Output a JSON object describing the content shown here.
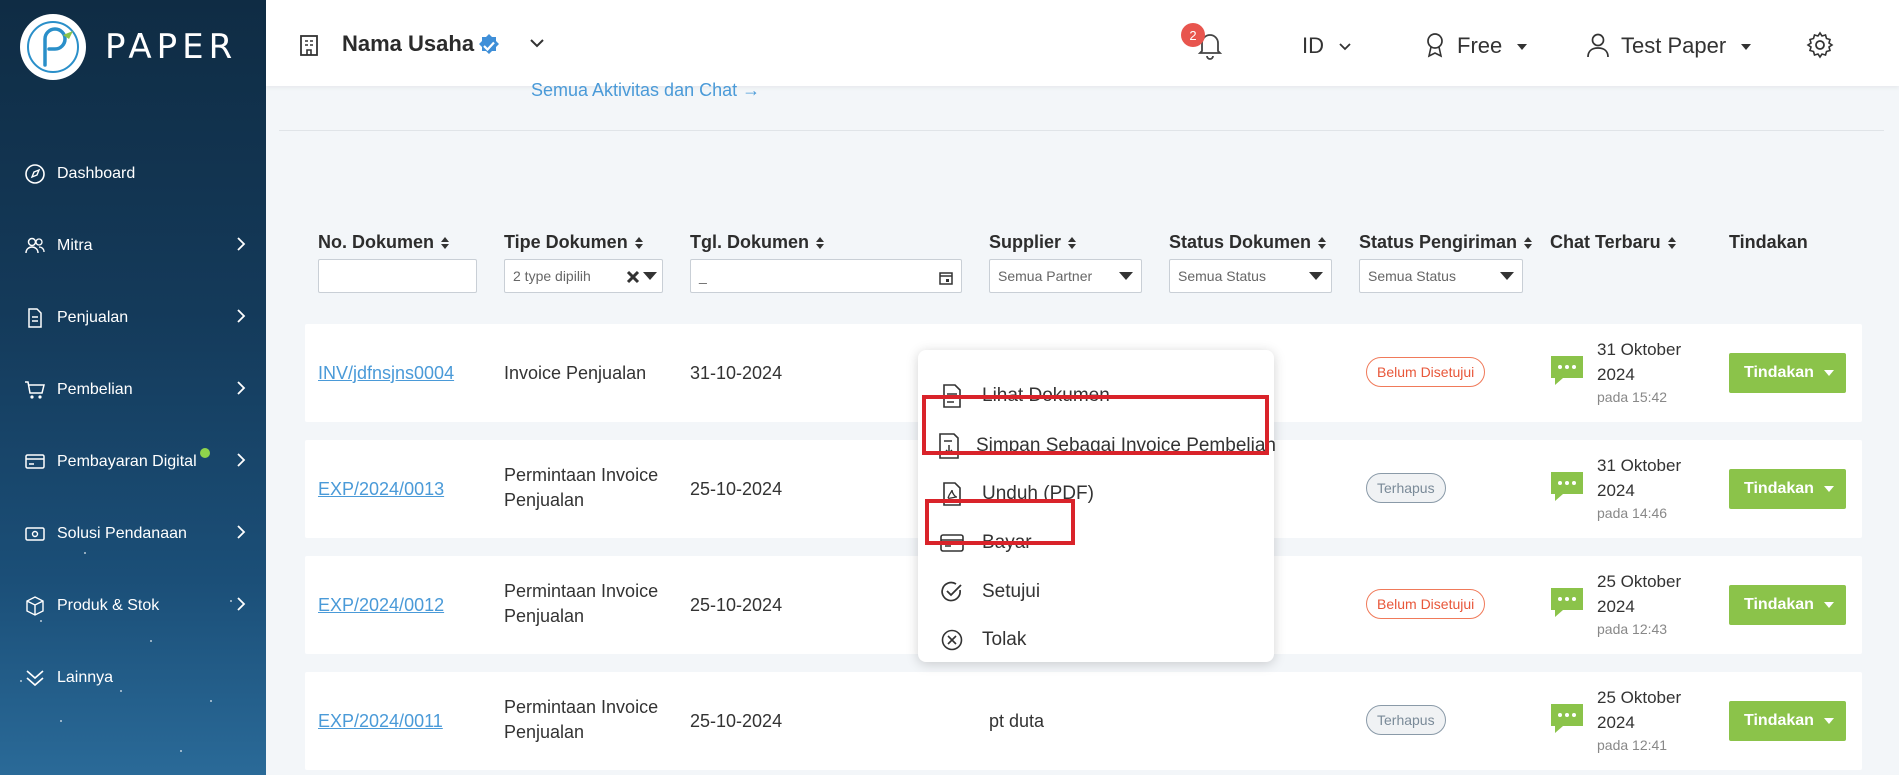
{
  "brand": {
    "name": "PAPER"
  },
  "sidebar": {
    "items": [
      {
        "label": "Dashboard",
        "icon": "dashboard-icon",
        "chevron": false
      },
      {
        "label": "Mitra",
        "icon": "users-icon",
        "chevron": true
      },
      {
        "label": "Penjualan",
        "icon": "document-icon",
        "chevron": true
      },
      {
        "label": "Pembelian",
        "icon": "cart-icon",
        "chevron": true
      },
      {
        "label": "Pembayaran Digital",
        "icon": "payment-icon",
        "chevron": true,
        "dot": true
      },
      {
        "label": "Solusi Pendanaan",
        "icon": "funding-icon",
        "chevron": true
      },
      {
        "label": "Produk & Stok",
        "icon": "box-icon",
        "chevron": true
      },
      {
        "label": "Lainnya",
        "icon": "more-icon",
        "chevron": false
      }
    ]
  },
  "header": {
    "business_name": "Nama Usaha",
    "notification_count": "2",
    "language": "ID",
    "plan": "Free",
    "user": "Test Paper"
  },
  "activity_link": "Semua Aktivitas dan Chat  →",
  "table": {
    "columns": {
      "no_dokumen": "No. Dokumen",
      "tipe_dokumen": "Tipe Dokumen",
      "tgl_dokumen": "Tgl. Dokumen",
      "supplier": "Supplier",
      "status_dokumen": "Status Dokumen",
      "status_pengiriman": "Status Pengiriman",
      "chat_terbaru": "Chat Terbaru",
      "tindakan": "Tindakan"
    },
    "filters": {
      "tipe": "2 type dipilih",
      "tgl": "_",
      "supplier": "Semua Partner",
      "status_dokumen": "Semua Status",
      "status_pengiriman": "Semua Status"
    },
    "rows": [
      {
        "no": "INV/jdfnsjns0004",
        "type": "Invoice Penjualan",
        "type2": "",
        "date": "31-10-2024",
        "supplier": "",
        "status": "Belum Disetujui",
        "status_color": "red",
        "chat_date1": "31 Oktober",
        "chat_date2": "2024",
        "chat_time": "pada 15:42",
        "action": "Tindakan"
      },
      {
        "no": "EXP/2024/0013",
        "type": "Permintaan Invoice",
        "type2": "Penjualan",
        "date": "25-10-2024",
        "supplier": "",
        "status": "Terhapus",
        "status_color": "grey",
        "chat_date1": "31 Oktober",
        "chat_date2": "2024",
        "chat_time": "pada 14:46",
        "action": "Tindakan"
      },
      {
        "no": "EXP/2024/0012",
        "type": "Permintaan Invoice",
        "type2": "Penjualan",
        "date": "25-10-2024",
        "supplier": "",
        "status": "Belum Disetujui",
        "status_color": "red",
        "chat_date1": "25 Oktober",
        "chat_date2": "2024",
        "chat_time": "pada 12:43",
        "action": "Tindakan"
      },
      {
        "no": "EXP/2024/0011",
        "type": "Permintaan Invoice",
        "type2": "Penjualan",
        "date": "25-10-2024",
        "supplier": "pt duta",
        "status": "Terhapus",
        "status_color": "grey",
        "chat_date1": "25 Oktober",
        "chat_date2": "2024",
        "chat_time": "pada 12:41",
        "action": "Tindakan"
      }
    ]
  },
  "menu": {
    "items": [
      {
        "label": "Lihat Dokumen",
        "icon": "view-document-icon"
      },
      {
        "label": "Simpan Sebagai Invoice Pembelian",
        "icon": "save-invoice-icon",
        "highlighted": true
      },
      {
        "label": "Unduh (PDF)",
        "icon": "pdf-download-icon"
      },
      {
        "label": "Bayar",
        "icon": "card-pay-icon",
        "highlighted": true
      },
      {
        "label": "Setujui",
        "icon": "approve-icon"
      },
      {
        "label": "Tolak",
        "icon": "reject-icon"
      }
    ]
  },
  "colors": {
    "accent_green": "#8bc34a",
    "link_blue": "#4a9ad8",
    "highlight_red": "#d9232a",
    "sidebar_dark": "#0f2c44"
  }
}
